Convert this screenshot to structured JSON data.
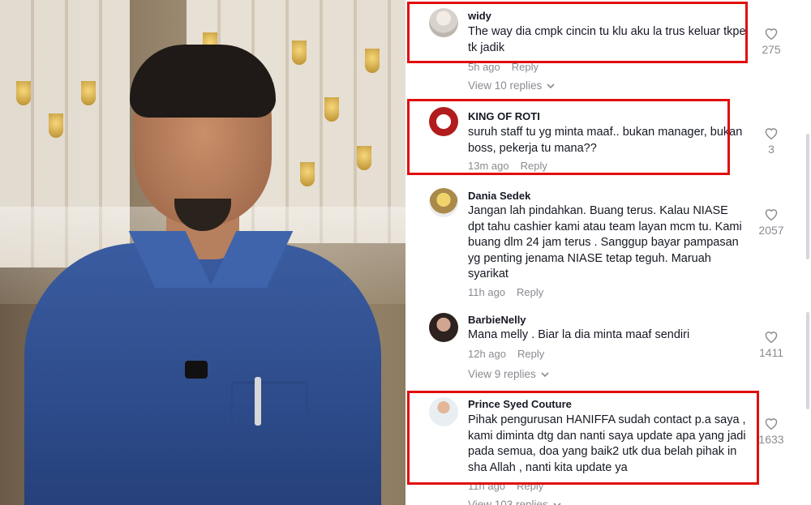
{
  "comments": [
    {
      "username": "widy",
      "text": "The way dia cmpk cincin tu klu aku la trus keluar tkpe tk jadik",
      "time": "5h ago",
      "reply_label": "Reply",
      "likes": "275",
      "view_replies": "View 10 replies"
    },
    {
      "username": "KING OF ROTI",
      "text": "suruh staff tu yg minta maaf.. bukan manager, bukan boss, pekerja tu mana??",
      "time": "13m ago",
      "reply_label": "Reply",
      "likes": "3"
    },
    {
      "username": "Dania Sedek",
      "text": "Jangan lah pindahkan. Buang terus. Kalau NIASE dpt tahu cashier kami atau team layan mcm tu. Kami buang dlm 24 jam terus . Sanggup bayar pampasan yg penting jenama NIASE tetap teguh. Maruah syarikat",
      "time": "11h ago",
      "reply_label": "Reply",
      "likes": "2057"
    },
    {
      "username": "BarbieNelly",
      "text": "Mana melly . Biar la dia minta maaf sendiri",
      "time": "12h ago",
      "reply_label": "Reply",
      "likes": "1411",
      "view_replies": "View 9 replies"
    },
    {
      "username": "Prince Syed Couture",
      "text": "Pihak pengurusan HANIFFA sudah contact p.a saya , kami diminta dtg dan nanti saya update apa yang jadi pada semua, doa yang baik2 utk dua belah pihak in sha Allah , nanti kita update ya",
      "time": "11h ago",
      "reply_label": "Reply",
      "likes": "1633",
      "view_replies": "View 103 replies"
    }
  ],
  "icons": {
    "like": "heart-outline-icon",
    "expand": "chevron-down-icon"
  },
  "colors": {
    "highlight": "#e10d0d",
    "muted_text": "#8a8b91",
    "primary_text": "#161823"
  }
}
